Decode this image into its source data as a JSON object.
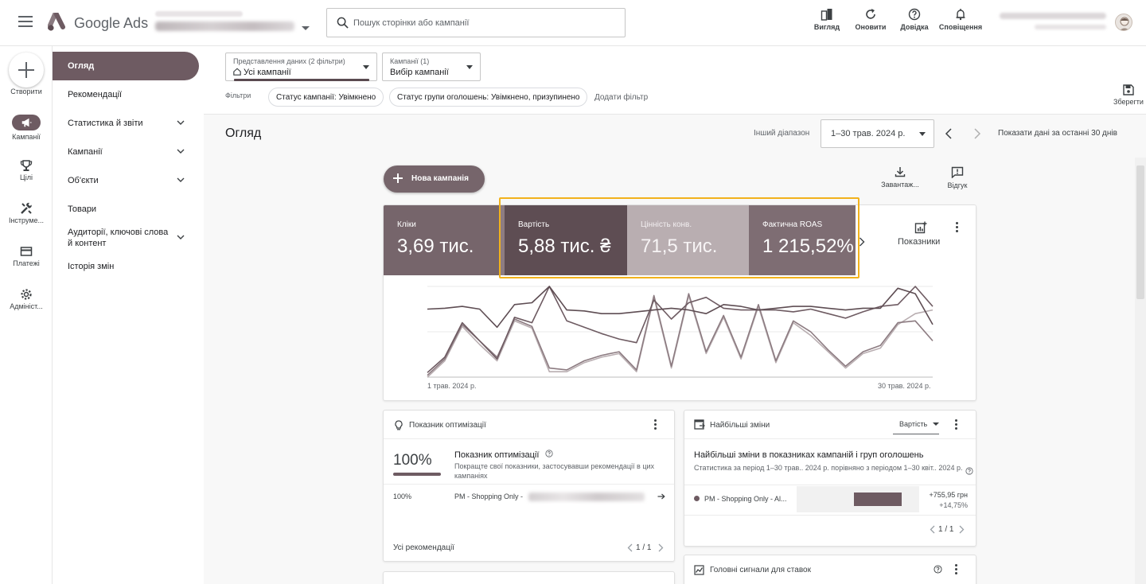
{
  "app": {
    "logo_text": "Google Ads"
  },
  "search": {
    "placeholder": "Пошук сторінки або кампанії"
  },
  "toolbar": [
    {
      "label": "Вигляд",
      "icon": "appearance-icon"
    },
    {
      "label": "Оновити",
      "icon": "refresh-icon"
    },
    {
      "label": "Довідка",
      "icon": "help-icon"
    },
    {
      "label": "Сповіщення",
      "icon": "bell-icon"
    }
  ],
  "rail": {
    "create": "Створити",
    "items": [
      {
        "label": "Кампанії",
        "icon": "megaphone-icon",
        "active": true
      },
      {
        "label": "Цілі",
        "icon": "trophy-icon"
      },
      {
        "label": "Інструме...",
        "icon": "tools-icon"
      },
      {
        "label": "Платежі",
        "icon": "card-icon"
      },
      {
        "label": "Адмініст...",
        "icon": "gear-icon"
      }
    ]
  },
  "nav": {
    "items": [
      {
        "label": "Огляд",
        "active": true
      },
      {
        "label": "Рекомендації"
      },
      {
        "label": "Статистика й звіти",
        "expandable": true
      },
      {
        "label": "Кампанії",
        "expandable": true
      },
      {
        "label": "Об'єкти",
        "expandable": true
      },
      {
        "label": "Товари"
      },
      {
        "label": "Аудиторії, ключові слова й контент",
        "expandable": true
      },
      {
        "label": "Історія змін"
      }
    ]
  },
  "filterbar": {
    "view_small": "Представлення даних (2 фільтри)",
    "view_value": "Усі кампанії",
    "campaigns_small": "Кампанії (1)",
    "campaigns_value": "Вибір кампанії",
    "filters_label": "Фільтри",
    "chips": [
      "Статус кампанії: Увімкнено",
      "Статус групи оголошень: Увімкнено, призупинено"
    ],
    "add_filter": "Додати фільтр",
    "save": "Зберегти"
  },
  "header": {
    "title": "Огляд",
    "other_range": "Інший діапазон",
    "date_range": "1–30 трав. 2024 р.",
    "last_30": "Показати дані за останні 30 днів"
  },
  "actions": {
    "new_campaign": "Нова кампанія",
    "download": "Завантаж...",
    "feedback": "Відгук"
  },
  "metrics": [
    {
      "label": "Кліки",
      "value": "3,69 тис.",
      "color": "#76656b"
    },
    {
      "label": "Вартість",
      "value": "5,88 тис. ₴",
      "color": "#5e4d53"
    },
    {
      "label": "Цінність конв.",
      "value": "71,5 тис.",
      "color": "#b9aeb1"
    },
    {
      "label": "Фактична ROAS",
      "value": "1 215,52%",
      "color": "#7e6d73"
    }
  ],
  "metrics_button": "Показники",
  "chart_data": {
    "type": "line",
    "x_start_label": "1 трав. 2024 р.",
    "x_end_label": "30 трав. 2024 р.",
    "series": [
      {
        "values": [
          75,
          76,
          78,
          75,
          55,
          80,
          82,
          100,
          74,
          73,
          70,
          70,
          72,
          74,
          76,
          74,
          70,
          80,
          78,
          74,
          76,
          78,
          78,
          76,
          74,
          76,
          76,
          98,
          92,
          58
        ]
      },
      {
        "values": [
          5,
          22,
          60,
          40,
          20,
          66,
          60,
          100,
          62,
          55,
          48,
          42,
          38,
          85,
          64,
          82,
          88,
          76,
          74,
          74,
          74,
          72,
          75,
          70,
          65,
          72,
          78,
          80,
          100,
          78
        ]
      },
      {
        "values": [
          2,
          20,
          58,
          40,
          22,
          64,
          56,
          10,
          8,
          18,
          24,
          28,
          8,
          90,
          12,
          92,
          28,
          68,
          22,
          80,
          18,
          62,
          50,
          30,
          12,
          28,
          35,
          60,
          62,
          40
        ]
      },
      {
        "values": [
          0,
          18,
          56,
          36,
          18,
          62,
          54,
          6,
          6,
          16,
          22,
          26,
          6,
          88,
          10,
          90,
          26,
          66,
          20,
          78,
          16,
          60,
          46,
          28,
          10,
          26,
          32,
          58,
          70,
          74
        ]
      }
    ],
    "colors": [
      "#5e4d53",
      "#6e5b62",
      "#8c7b81",
      "#b9aeb1"
    ],
    "ylim": [
      0,
      100
    ],
    "grid": true
  },
  "optimization": {
    "header": "Показник оптимізації",
    "score": "100%",
    "title": "Показник оптимізації",
    "desc": "Покращте свої показники, застосувавши рекомендації в цих кампаніях",
    "row_score": "100%",
    "row_campaign": "PM - Shopping Only -",
    "footer": "Усі рекомендації",
    "pager": "1 / 1"
  },
  "changes": {
    "header": "Найбільші зміни",
    "metric_select": "Вартість",
    "title": "Найбільші зміни в показниках кампаній і груп оголошень",
    "desc": "Статистика за період 1–30 трав.. 2024 р. порівняно з періодом 1–30 квіт.. 2024 р.",
    "row_campaign": "PM - Shopping Only - Al...",
    "row_value": "+755,95 грн",
    "row_percent": "+14,75%",
    "row_bar_fraction": 0.75,
    "pager": "1 / 1"
  },
  "signals": {
    "header": "Головні сигнали для ставок"
  }
}
